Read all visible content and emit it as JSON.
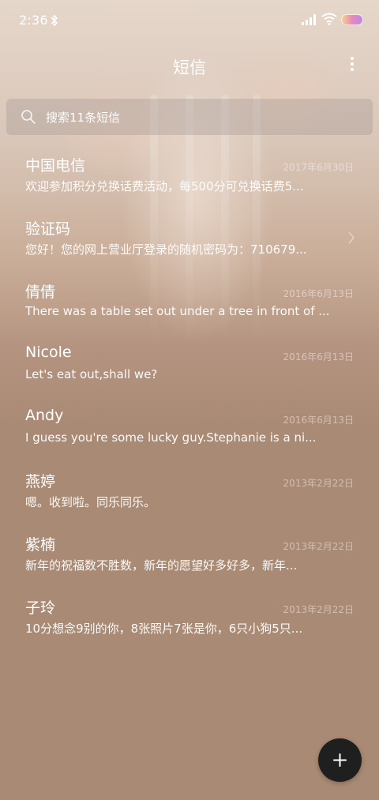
{
  "status_bar": {
    "time": "2:36",
    "icons": [
      "bluetooth-icon",
      "signal-icon",
      "wifi-icon",
      "battery-icon"
    ]
  },
  "header": {
    "title": "短信",
    "more_icon": "more-vertical-icon"
  },
  "search": {
    "placeholder": "搜索11条短信",
    "icon": "search-icon"
  },
  "messages": [
    {
      "name": "中国电信",
      "preview": "欢迎参加积分兑换话费活动，每500分可兑换话费5...",
      "date": "2017年6月30日"
    },
    {
      "name": "验证码",
      "preview": "您好！您的网上营业厅登录的随机密码为：710679...",
      "date": ""
    },
    {
      "name": "倩倩",
      "preview": "There was a table set out under a tree in front of ...",
      "date": "2016年6月13日"
    },
    {
      "name": "Nicole",
      "preview": "Let's eat out,shall we?",
      "date": "2016年6月13日"
    },
    {
      "name": "Andy",
      "preview": "I guess you're some lucky guy.Stephanie is a ni...",
      "date": "2016年6月13日"
    },
    {
      "name": "燕婷",
      "preview": "嗯。收到啦。同乐同乐。",
      "date": "2013年2月22日"
    },
    {
      "name": "紫楠",
      "preview": "新年的祝福数不胜数，新年的愿望好多好多，新年...",
      "date": "2013年2月22日"
    },
    {
      "name": "子玲",
      "preview": "10分想念9别的你，8张照片7张是你，6只小狗5只...",
      "date": "2013年2月22日"
    }
  ],
  "compose": {
    "icon": "plus-icon"
  },
  "colors": {
    "background": "#a98a74",
    "text": "#ffffff",
    "compose_button": "#1f1f1f"
  }
}
